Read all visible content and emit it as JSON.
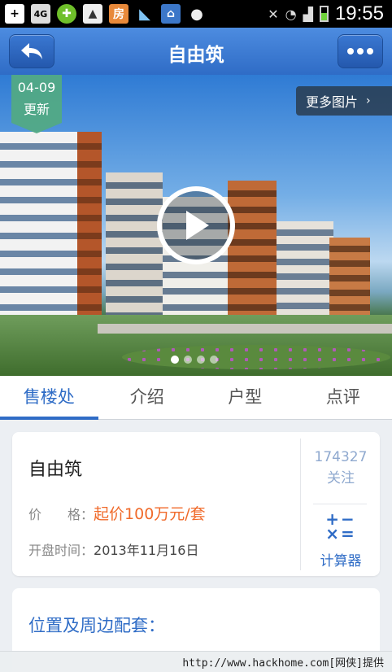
{
  "status_bar": {
    "time": "19:55",
    "notification_icons": [
      "plus-icon",
      "sim-icon",
      "gift-icon",
      "image-icon",
      "fang-app-icon",
      "bird-icon",
      "house-app-icon",
      "wechat-icon"
    ],
    "fang_label": "房"
  },
  "header": {
    "title": "自由筑",
    "back_icon": "back-arrow-icon",
    "more_icon": "more-dots-icon"
  },
  "hero": {
    "badge_date": "04-09",
    "badge_text": "更新",
    "more_photos_label": "更多图片",
    "dots_total": 4,
    "active_dot": 1
  },
  "tabs": [
    {
      "label": "售楼处",
      "active": true
    },
    {
      "label": "介绍",
      "active": false
    },
    {
      "label": "户型",
      "active": false
    },
    {
      "label": "点评",
      "active": false
    }
  ],
  "info_card": {
    "name": "自由筑",
    "price_label": "价　　格：",
    "price_value": "起价100万元/套",
    "open_label": "开盘时间：",
    "open_value": "2013年11月16日",
    "follow_count": "174327",
    "follow_label": "关注",
    "calculator_label": "计算器"
  },
  "location_card": {
    "title": "位置及周边配套："
  },
  "watermark": "http://www.hackhome.com[网侠]提供",
  "colors": {
    "brand_blue": "#2f6cc6",
    "price_orange": "#f06a2a",
    "badge_green": "#52aa82"
  }
}
